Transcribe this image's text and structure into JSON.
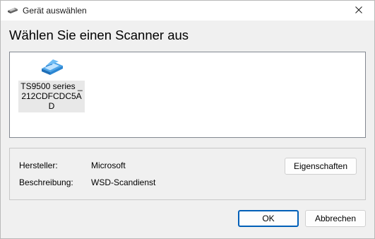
{
  "window": {
    "title": "Gerät auswählen",
    "icon": "scanner-icon",
    "close_icon": "close-icon"
  },
  "heading": "Wählen Sie einen Scanner aus",
  "devices": [
    {
      "label": "TS9500 series _212CDFCDC5AD",
      "icon": "scanner-icon",
      "selected": false
    }
  ],
  "info": {
    "manufacturer_label": "Hersteller:",
    "manufacturer_value": "Microsoft",
    "description_label": "Beschreibung:",
    "description_value": "WSD-Scandienst",
    "properties_button": "Eigenschaften"
  },
  "buttons": {
    "ok": "OK",
    "cancel": "Abbrechen"
  },
  "colors": {
    "accent": "#005fb8",
    "scanner_blue": "#3a8fd8"
  }
}
